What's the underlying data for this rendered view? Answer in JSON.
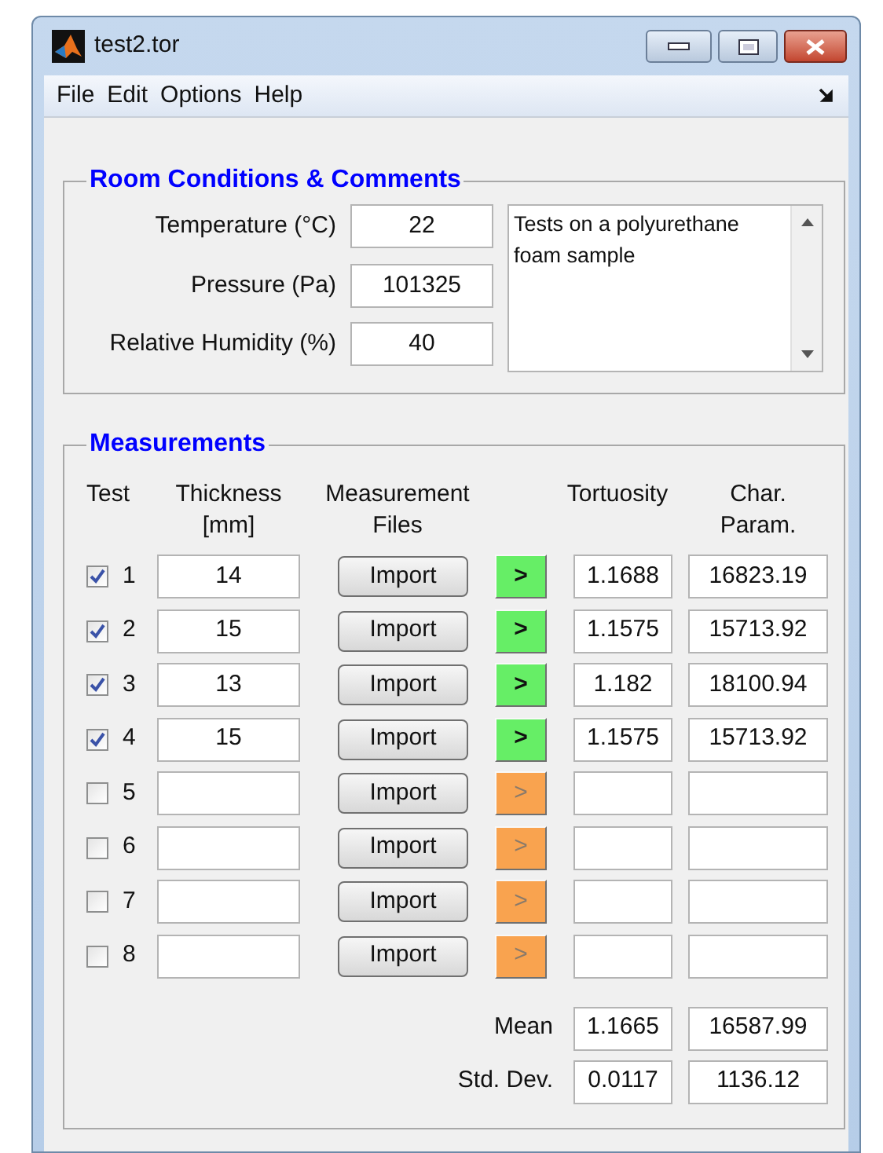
{
  "window": {
    "title": "test2.tor"
  },
  "menu": [
    "File",
    "Edit",
    "Options",
    "Help"
  ],
  "room_conditions": {
    "title": "Room Conditions & Comments",
    "fields": [
      {
        "label": "Temperature (°C)",
        "value": "22"
      },
      {
        "label": "Pressure (Pa)",
        "value": "101325"
      },
      {
        "label": "Relative Humidity (%)",
        "value": "40"
      }
    ],
    "comments": "Tests on a polyurethane foam sample"
  },
  "measurements": {
    "title": "Measurements",
    "columns": [
      "Test",
      "Thickness\n[mm]",
      "Measurement\nFiles",
      "Tortuosity",
      "Char.\nParam."
    ],
    "rows": [
      {
        "number": "1",
        "checked": true,
        "thickness": "14",
        "import": "Import",
        "arrow": ">",
        "enabled": true,
        "tortuosity": "1.1688",
        "char_param": "16823.19"
      },
      {
        "number": "2",
        "checked": true,
        "thickness": "15",
        "import": "Import",
        "arrow": ">",
        "enabled": true,
        "tortuosity": "1.1575",
        "char_param": "15713.92"
      },
      {
        "number": "3",
        "checked": true,
        "thickness": "13",
        "import": "Import",
        "arrow": ">",
        "enabled": true,
        "tortuosity": "1.182",
        "char_param": "18100.94"
      },
      {
        "number": "4",
        "checked": true,
        "thickness": "15",
        "import": "Import",
        "arrow": ">",
        "enabled": true,
        "tortuosity": "1.1575",
        "char_param": "15713.92"
      },
      {
        "number": "5",
        "checked": false,
        "thickness": "",
        "import": "Import",
        "arrow": ">",
        "enabled": false,
        "tortuosity": "",
        "char_param": ""
      },
      {
        "number": "6",
        "checked": false,
        "thickness": "",
        "import": "Import",
        "arrow": ">",
        "enabled": false,
        "tortuosity": "",
        "char_param": ""
      },
      {
        "number": "7",
        "checked": false,
        "thickness": "",
        "import": "Import",
        "arrow": ">",
        "enabled": false,
        "tortuosity": "",
        "char_param": ""
      },
      {
        "number": "8",
        "checked": false,
        "thickness": "",
        "import": "Import",
        "arrow": ">",
        "enabled": false,
        "tortuosity": "",
        "char_param": ""
      }
    ],
    "summary": [
      {
        "label": "Mean",
        "tortuosity": "1.1665",
        "char_param": "16587.99"
      },
      {
        "label": "Std. Dev.",
        "tortuosity": "0.0117",
        "char_param": "1136.12"
      }
    ]
  }
}
